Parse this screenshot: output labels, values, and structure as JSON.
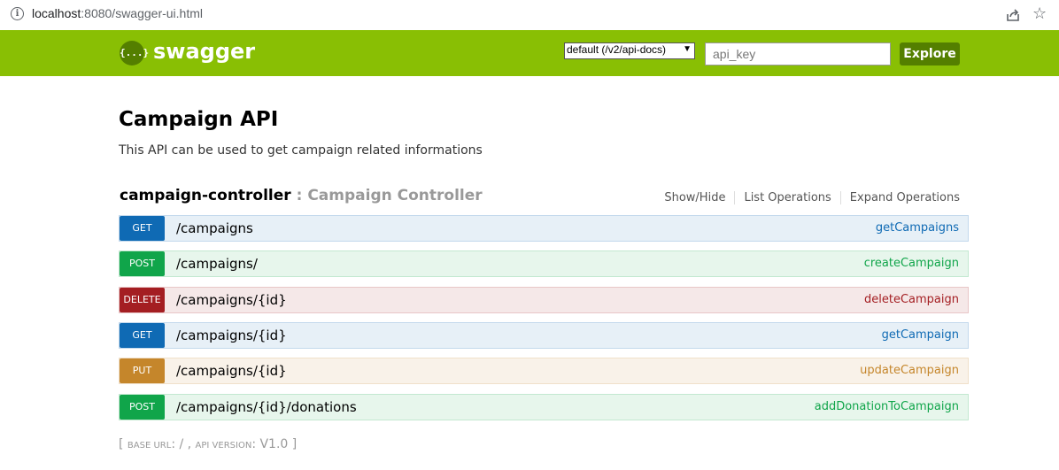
{
  "browser": {
    "url_host": "localhost",
    "url_path": ":8080/swagger-ui.html"
  },
  "header": {
    "logo_symbol": "{...}",
    "logo_text": "swagger",
    "spec_select_value": "default (/v2/api-docs)",
    "api_key_placeholder": "api_key",
    "explore_label": "Explore",
    "colors": {
      "header_bg": "#89bf04",
      "explore_bg": "#547f00"
    }
  },
  "api": {
    "title": "Campaign API",
    "description": "This API can be used to get campaign related informations"
  },
  "controller": {
    "name": "campaign-controller",
    "separator": " : ",
    "description": "Campaign Controller",
    "links": [
      "Show/Hide",
      "List Operations",
      "Expand Operations"
    ]
  },
  "operations": [
    {
      "method": "GET",
      "path": "/campaigns",
      "name": "getCampaigns"
    },
    {
      "method": "POST",
      "path": "/campaigns/",
      "name": "createCampaign"
    },
    {
      "method": "DELETE",
      "path": "/campaigns/{id}",
      "name": "deleteCampaign"
    },
    {
      "method": "GET",
      "path": "/campaigns/{id}",
      "name": "getCampaign"
    },
    {
      "method": "PUT",
      "path": "/campaigns/{id}",
      "name": "updateCampaign"
    },
    {
      "method": "POST",
      "path": "/campaigns/{id}/donations",
      "name": "addDonationToCampaign"
    }
  ],
  "footer": {
    "open": "[ ",
    "base_url_label": "BASE URL",
    "base_url_value": ": / , ",
    "api_version_label": "API VERSION",
    "api_version_value": ": V1.0 ]"
  }
}
